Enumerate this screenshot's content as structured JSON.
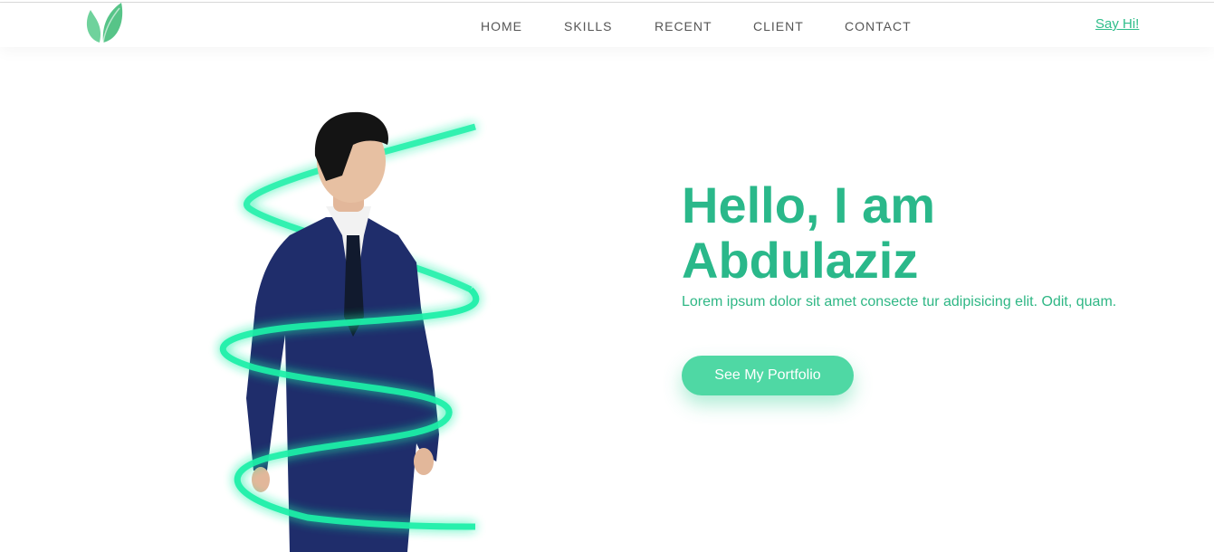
{
  "brand": {
    "logo_icon": "leaf-icon",
    "accent_color": "#2ab88a"
  },
  "nav": {
    "items": [
      {
        "label": "HOME"
      },
      {
        "label": "SKILLS"
      },
      {
        "label": "RECENT"
      },
      {
        "label": "CLIENT"
      },
      {
        "label": "CONTACT"
      }
    ],
    "cta_label": "Say Hi!"
  },
  "hero": {
    "title_line1": "Hello, I am",
    "title_line2": "Abdulaziz",
    "subtitle": "Lorem ipsum dolor sit amet consecte tur adipisicing elit. Odit, quam.",
    "button_label": "See My Portfolio",
    "button_color": "#4fd8a4",
    "image_icon": "portrait-photo"
  }
}
